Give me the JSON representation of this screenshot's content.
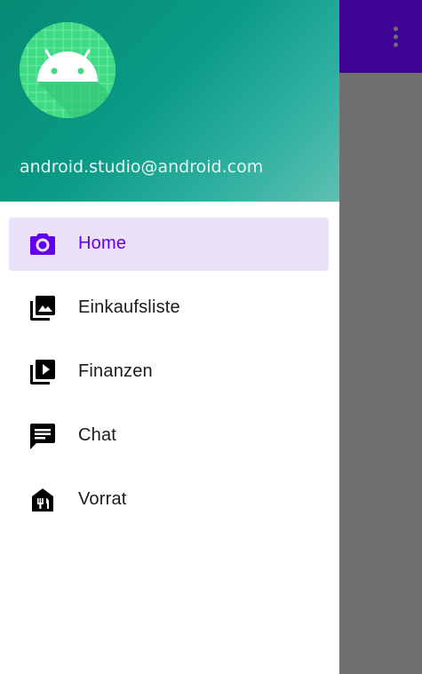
{
  "app_bar": {
    "overflow_icon": "more-vert-icon",
    "color": "#3f0396"
  },
  "background_fragment": "t",
  "drawer": {
    "header": {
      "avatar_icon": "android-logo-icon",
      "email": "android.studio@android.com",
      "gradient_colors": [
        "#068a74",
        "#5dc0b2"
      ]
    },
    "items": [
      {
        "label": "Home",
        "icon": "camera-icon",
        "active": true
      },
      {
        "label": "Einkaufsliste",
        "icon": "photo-library-icon",
        "active": false
      },
      {
        "label": "Finanzen",
        "icon": "video-library-icon",
        "active": false
      },
      {
        "label": "Chat",
        "icon": "chat-icon",
        "active": false
      },
      {
        "label": "Vorrat",
        "icon": "pantry-icon",
        "active": false
      }
    ],
    "accent_color": "#6200ee",
    "active_bg": "#ebe1fb"
  }
}
